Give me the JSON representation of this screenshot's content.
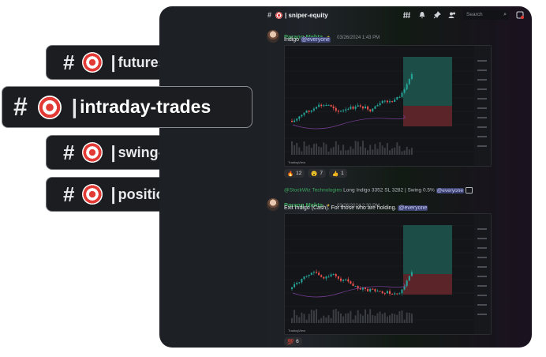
{
  "channel_pills": [
    {
      "name": "futures-options"
    },
    {
      "name": "intraday-trades"
    },
    {
      "name": "swing-trades"
    },
    {
      "name": "positional-trades"
    }
  ],
  "topbar": {
    "channel_title": "| sniper-equity",
    "search_placeholder": "Search"
  },
  "messages": [
    {
      "author": "Parang Mehta",
      "timestamp": "03/26/2024 1:43 PM",
      "text": "Indigo",
      "mention": "@everyone",
      "reactions": [
        {
          "emoji": "🔥",
          "count": "12"
        },
        {
          "emoji": "😮",
          "count": "7"
        },
        {
          "emoji": "👍",
          "count": "1"
        }
      ]
    },
    {
      "reply_author": "@StockWiz Technologies",
      "reply_text": "Long Indigo 3352 SL 3282 | Swing 0.5%",
      "reply_mention": "@everyone",
      "author": "Parang Mehta",
      "timestamp": "03/26/2024 2:30 PM",
      "text": "Exit Indigo (Cash). For those who are holding.",
      "mention": "@everyone",
      "reactions": [
        {
          "emoji": "💯",
          "count": "6"
        }
      ]
    }
  ],
  "chart_brand": "TradingView",
  "colors": {
    "author_green": "#3ba55d",
    "candle_up": "#26a69a",
    "candle_down": "#ef5350",
    "target_zone": "#1d4d47",
    "stop_zone": "#5a2428"
  }
}
